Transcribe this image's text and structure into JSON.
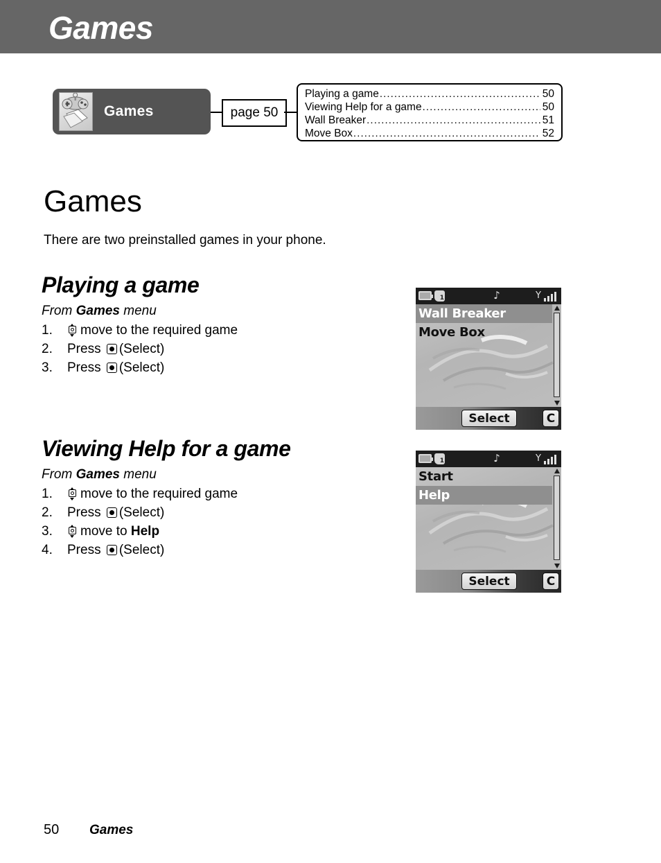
{
  "header": {
    "title": "Games"
  },
  "banner": {
    "chip_label": "Games",
    "chip_icon": "gamepad-cards-icon",
    "page_ref": "page 50",
    "toc": [
      {
        "title": "Playing a game",
        "dots": "................................................................................",
        "page": "50"
      },
      {
        "title": "Viewing Help for a game",
        "dots": "................................................................................",
        "page": "50"
      },
      {
        "title": "Wall Breaker",
        "dots": "................................................................................",
        "page": "51"
      },
      {
        "title": "Move Box",
        "dots": "................................................................................",
        "page": "52"
      }
    ]
  },
  "main": {
    "title": "Games",
    "intro": "There are two preinstalled games in your phone.",
    "sections": [
      {
        "heading": "Playing a game",
        "from_prefix": "From ",
        "from_bold": "Games",
        "from_suffix": " menu",
        "steps": [
          {
            "num": "1.",
            "icon": "nav-key-icon",
            "text_before": "",
            "text_after": "move to the required game",
            "bold_after": ""
          },
          {
            "num": "2.",
            "icon": "select-key-icon",
            "text_before": "Press ",
            "text_after": "(Select)",
            "bold_after": ""
          },
          {
            "num": "3.",
            "icon": "select-key-icon",
            "text_before": "Press ",
            "text_after": "(Select)",
            "bold_after": ""
          }
        ]
      },
      {
        "heading": "Viewing Help for a game",
        "from_prefix": "From ",
        "from_bold": "Games",
        "from_suffix": " menu",
        "steps": [
          {
            "num": "1.",
            "icon": "nav-key-icon",
            "text_before": "",
            "text_after": "move to the required game",
            "bold_after": ""
          },
          {
            "num": "2.",
            "icon": "select-key-icon",
            "text_before": "Press ",
            "text_after": "(Select)",
            "bold_after": ""
          },
          {
            "num": "3.",
            "icon": "nav-key-icon",
            "text_before": "",
            "text_after": "move to ",
            "bold_after": "Help"
          },
          {
            "num": "4.",
            "icon": "select-key-icon",
            "text_before": "Press ",
            "text_after": "(Select)",
            "bold_after": ""
          }
        ]
      }
    ]
  },
  "screens": [
    {
      "name": "game-list-screen",
      "status": {
        "battery": "battery-icon",
        "line_indicator": "1",
        "music": "♪",
        "signal": "signal-bars-icon"
      },
      "rows": [
        {
          "label": "Wall Breaker",
          "selected": true
        },
        {
          "label": "Move Box",
          "selected": false
        }
      ],
      "softkeys": {
        "center": "Select",
        "right": "C"
      }
    },
    {
      "name": "game-menu-screen",
      "status": {
        "battery": "battery-icon",
        "line_indicator": "1",
        "music": "♪",
        "signal": "signal-bars-icon"
      },
      "rows": [
        {
          "label": "Start",
          "selected": false
        },
        {
          "label": "Help",
          "selected": true
        }
      ],
      "softkeys": {
        "center": "Select",
        "right": "C"
      }
    }
  ],
  "footer": {
    "page_number": "50",
    "chapter": "Games"
  },
  "colors": {
    "header_bar": "#666666",
    "chip_bg": "#545454",
    "screen_bg": "#b9b9b9",
    "status_bg": "#1d1d1d",
    "highlight": "#8f8f8f"
  }
}
